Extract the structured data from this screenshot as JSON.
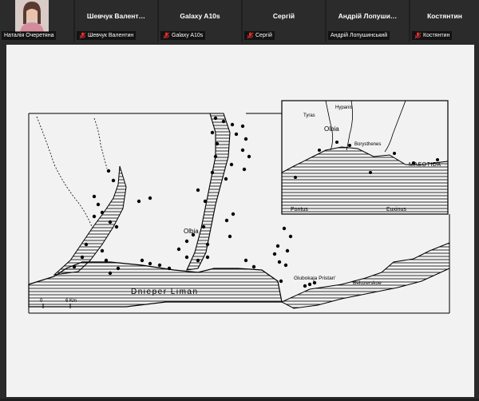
{
  "participants": [
    {
      "id": "p1",
      "display_name": "",
      "label": "Наталія Очеретяна",
      "muted": false,
      "has_video": true
    },
    {
      "id": "p2",
      "display_name": "Шевчук  Валент…",
      "label": "Шевчук Валентин",
      "muted": true,
      "has_video": false
    },
    {
      "id": "p3",
      "display_name": "Galaxy A10s",
      "label": "Galaxy A10s",
      "muted": true,
      "has_video": false
    },
    {
      "id": "p4",
      "display_name": "Сергій",
      "label": "Сергій",
      "muted": true,
      "has_video": false
    },
    {
      "id": "p5",
      "display_name": "Андрій  Лопуши…",
      "label": "Андрій Лопушинський",
      "muted": false,
      "has_video": false
    },
    {
      "id": "p6",
      "display_name": "Костянтин",
      "label": "Костянтин",
      "muted": true,
      "has_video": false
    }
  ],
  "colors": {
    "muted_icon": "#e02f2f",
    "tile_bg": "#2b2b2b",
    "share_bg": "#f2f2f2"
  },
  "map": {
    "main_labels": {
      "liman": "Dnieper Liman",
      "olbia": "Olbia",
      "glubokaja": "Glubokaja Pristan'",
      "belozerskoe": "Belozerskoe",
      "scale_zero": "0",
      "scale_km": "6 Km"
    },
    "inset_labels": {
      "olbia": "Olbia",
      "tyras": "Tyras",
      "hypanis": "Hypanis",
      "borysthenes": "Borysthenes",
      "maeotida": "MAEOTIDA",
      "pontus": "Pontus",
      "euxinus": "Euxinus"
    }
  }
}
